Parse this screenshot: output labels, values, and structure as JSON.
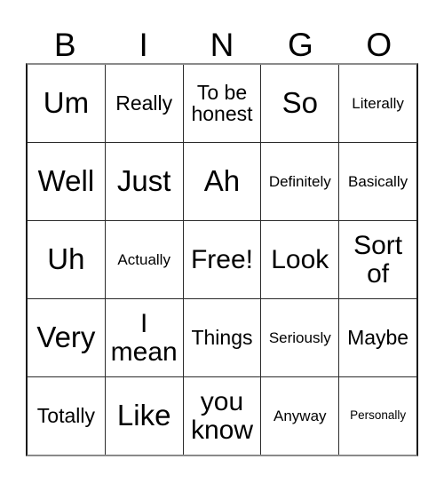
{
  "card": {
    "title_letters": [
      "B",
      "I",
      "N",
      "G",
      "O"
    ],
    "grid_rows": 5,
    "grid_cols": 5,
    "colors": {
      "background": "#ffffff",
      "text": "#000000",
      "grid_line": "#2b2b2b",
      "outer_border": "#1a1a1a"
    },
    "rows": [
      {
        "cells": [
          {
            "text": "Um",
            "size": "fs-xl"
          },
          {
            "text": "Really",
            "size": "fs-md"
          },
          {
            "text": "To be\nhonest",
            "size": "fs-md"
          },
          {
            "text": "So",
            "size": "fs-xl"
          },
          {
            "text": "Literally",
            "size": "fs-sm"
          }
        ]
      },
      {
        "cells": [
          {
            "text": "Well",
            "size": "fs-xl"
          },
          {
            "text": "Just",
            "size": "fs-xl"
          },
          {
            "text": "Ah",
            "size": "fs-xl"
          },
          {
            "text": "Definitely",
            "size": "fs-sm"
          },
          {
            "text": "Basically",
            "size": "fs-sm"
          }
        ]
      },
      {
        "cells": [
          {
            "text": "Uh",
            "size": "fs-xl"
          },
          {
            "text": "Actually",
            "size": "fs-sm"
          },
          {
            "text": "Free!",
            "size": "fs-lg"
          },
          {
            "text": "Look",
            "size": "fs-lg"
          },
          {
            "text": "Sort\nof",
            "size": "fs-lg"
          }
        ]
      },
      {
        "cells": [
          {
            "text": "Very",
            "size": "fs-xl"
          },
          {
            "text": "I\nmean",
            "size": "fs-lg"
          },
          {
            "text": "Things",
            "size": "fs-md"
          },
          {
            "text": "Seriously",
            "size": "fs-sm"
          },
          {
            "text": "Maybe",
            "size": "fs-md"
          }
        ]
      },
      {
        "cells": [
          {
            "text": "Totally",
            "size": "fs-md"
          },
          {
            "text": "Like",
            "size": "fs-xl"
          },
          {
            "text": "you\nknow",
            "size": "fs-lg"
          },
          {
            "text": "Anyway",
            "size": "fs-sm"
          },
          {
            "text": "Personally",
            "size": "fs-xxs"
          }
        ]
      }
    ]
  }
}
